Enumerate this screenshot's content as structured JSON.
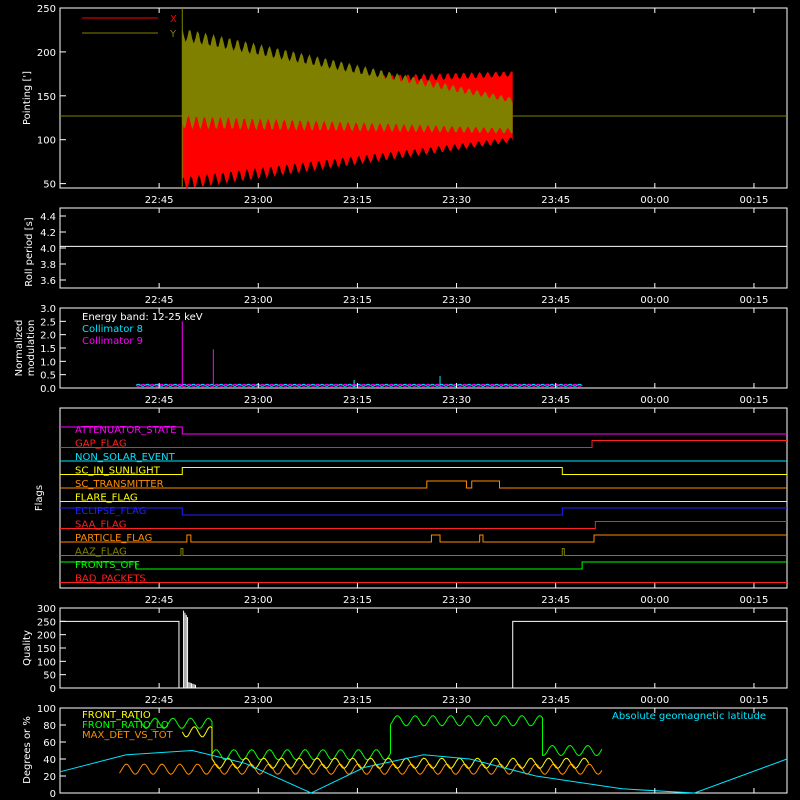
{
  "colors": {
    "background": "#000000",
    "axis": "#ffffff",
    "x": "#ff0000",
    "y": "#808000",
    "collimator8": "#00e5ff",
    "collimator9": "#ff00ff",
    "front_ratio": "#ffff00",
    "front_ratio_lo": "#00ff00",
    "max_det": "#ff8c00",
    "geomag": "#00e5ff"
  },
  "time_ticks": [
    "22:45",
    "23:00",
    "23:15",
    "23:30",
    "23:45",
    "00:00",
    "00:15"
  ],
  "panels": {
    "pointing": {
      "ylabel": "Pointing [']",
      "legend": [
        "X",
        "Y"
      ]
    },
    "roll": {
      "ylabel": "Roll period [s]"
    },
    "modulation": {
      "ylabel_1": "Normalized",
      "ylabel_2": "modulation",
      "energy_band": "Energy band: 12-25 keV",
      "legend": [
        "Collimator 8",
        "Collimator 9"
      ]
    },
    "flags": {
      "ylabel": "Flags"
    },
    "quality": {
      "ylabel": "Quality"
    },
    "ratios": {
      "ylabel": "Degrees or %",
      "legend": [
        "FRONT_RATIO",
        "FRONT_RATIO_LO",
        "MAX_DET_VS_TOT"
      ],
      "geomag_label": "Absolute geomagnetic latitude"
    }
  },
  "chart_data": [
    {
      "type": "area",
      "id": "pointing",
      "ylabel": "Pointing [']",
      "x_unit": "minutes after 22:30",
      "xlim": [
        0,
        110
      ],
      "ylim": [
        45,
        250
      ],
      "yticks": [
        50,
        100,
        150,
        200,
        250
      ],
      "baseline": 127,
      "x_start": 18.5,
      "x_end": 68.5,
      "series": [
        {
          "name": "X",
          "upper_start": 160,
          "upper_end": 175,
          "lower_start": 50,
          "lower_end": 100
        },
        {
          "name": "Y",
          "upper_start": 220,
          "upper_end": 145,
          "lower_start": 120,
          "lower_end": 110
        }
      ]
    },
    {
      "type": "line",
      "id": "roll",
      "ylabel": "Roll period [s]",
      "ylim": [
        3.5,
        4.5
      ],
      "yticks": [
        3.6,
        3.8,
        4.0,
        4.2,
        4.4
      ],
      "value": 4.02,
      "x_range": [
        0,
        110
      ]
    },
    {
      "type": "line",
      "id": "modulation",
      "ylim": [
        0,
        3.0
      ],
      "yticks": [
        0.0,
        0.5,
        1.0,
        1.5,
        2.0,
        2.5,
        3.0
      ],
      "x_range": [
        11.5,
        79
      ],
      "series": [
        {
          "name": "Collimator 8",
          "level": 0.08,
          "spikes": [
            [
              44.5,
              0.3
            ],
            [
              57.5,
              0.45
            ]
          ]
        },
        {
          "name": "Collimator 9",
          "level": 0.08,
          "spikes": [
            [
              18.5,
              2.5
            ],
            [
              23.2,
              1.45
            ]
          ]
        }
      ]
    },
    {
      "type": "line",
      "id": "flags",
      "x_range": [
        0,
        110
      ],
      "flags": [
        {
          "name": "ATTENUATOR_STATE",
          "color": "#ff00ff",
          "steps": [
            [
              0,
              1
            ],
            [
              18.5,
              0
            ]
          ]
        },
        {
          "name": "GAP_FLAG",
          "color": "#ff2020",
          "steps": [
            [
              0,
              0
            ],
            [
              80.5,
              1
            ]
          ]
        },
        {
          "name": "NON_SOLAR_EVENT",
          "color": "#00e5ff",
          "steps": [
            [
              0,
              0
            ]
          ]
        },
        {
          "name": "SC_IN_SUNLIGHT",
          "color": "#ffff00",
          "steps": [
            [
              0,
              0
            ],
            [
              18.5,
              1
            ],
            [
              76,
              0
            ]
          ]
        },
        {
          "name": "SC_TRANSMITTER",
          "color": "#ff8c00",
          "steps": [
            [
              0,
              0
            ],
            [
              55.5,
              1
            ],
            [
              61.5,
              0
            ],
            [
              62.3,
              1
            ],
            [
              66.5,
              0
            ]
          ]
        },
        {
          "name": "FLARE_FLAG",
          "color": "#ffff00",
          "steps": [
            [
              0,
              0
            ]
          ]
        },
        {
          "name": "ECLIPSE_FLAG",
          "color": "#2020ff",
          "steps": [
            [
              0,
              1
            ],
            [
              18.5,
              0
            ],
            [
              76,
              1
            ]
          ]
        },
        {
          "name": "SAA_FLAG",
          "color": "#ff2020",
          "steps": [
            [
              0,
              0
            ],
            [
              81,
              1
            ]
          ]
        },
        {
          "name": "PARTICLE_FLAG",
          "color": "#ff8c00",
          "steps": [
            [
              0,
              0
            ],
            [
              19.2,
              1
            ],
            [
              19.8,
              0
            ],
            [
              56.2,
              1
            ],
            [
              57.5,
              0
            ],
            [
              63.5,
              1
            ],
            [
              64,
              0
            ],
            [
              80.8,
              1
            ]
          ]
        },
        {
          "name": "AAZ_FLAG",
          "color": "#808000",
          "steps": [
            [
              0,
              0
            ],
            [
              18.3,
              1
            ],
            [
              18.6,
              0
            ],
            [
              76,
              1
            ],
            [
              76.3,
              0
            ]
          ]
        },
        {
          "name": "FRONTS_OFF",
          "color": "#00ff00",
          "steps": [
            [
              0,
              1
            ],
            [
              11.5,
              0
            ],
            [
              79,
              1
            ]
          ]
        },
        {
          "name": "BAD_PACKETS",
          "color": "#ff2020",
          "steps": [
            [
              0,
              0
            ]
          ]
        }
      ]
    },
    {
      "type": "line",
      "id": "quality",
      "ylabel": "Quality",
      "ylim": [
        0,
        300
      ],
      "yticks": [
        0,
        50,
        100,
        150,
        200,
        250,
        300
      ],
      "segments": [
        [
          0,
          18,
          250
        ],
        [
          68.5,
          110,
          250
        ]
      ],
      "spike": {
        "x": 19,
        "value": 290
      }
    },
    {
      "type": "line",
      "id": "ratios",
      "ylabel": "Degrees or %",
      "ylim": [
        0,
        100
      ],
      "yticks": [
        0,
        20,
        40,
        60,
        80,
        100
      ],
      "series": [
        {
          "name": "FRONT_RATIO",
          "segments": [
            [
              18.5,
              23,
              72
            ],
            [
              23,
              80,
              35
            ]
          ]
        },
        {
          "name": "FRONT_RATIO_LO",
          "segments": [
            [
              11.5,
              23,
              82
            ],
            [
              23,
              50,
              45
            ],
            [
              50,
              73,
              85
            ],
            [
              73,
              82,
              50
            ]
          ]
        },
        {
          "name": "MAX_DET_VS_TOT",
          "segments": [
            [
              9,
              82,
              28
            ]
          ]
        },
        {
          "name": "Absolute geomagnetic latitude",
          "curve": [
            [
              0,
              25
            ],
            [
              10,
              45
            ],
            [
              20,
              50
            ],
            [
              28,
              35
            ],
            [
              38,
              0
            ],
            [
              46,
              30
            ],
            [
              55,
              45
            ],
            [
              62,
              40
            ],
            [
              72,
              20
            ],
            [
              85,
              5
            ],
            [
              96,
              0
            ],
            [
              110,
              40
            ]
          ]
        }
      ]
    }
  ]
}
